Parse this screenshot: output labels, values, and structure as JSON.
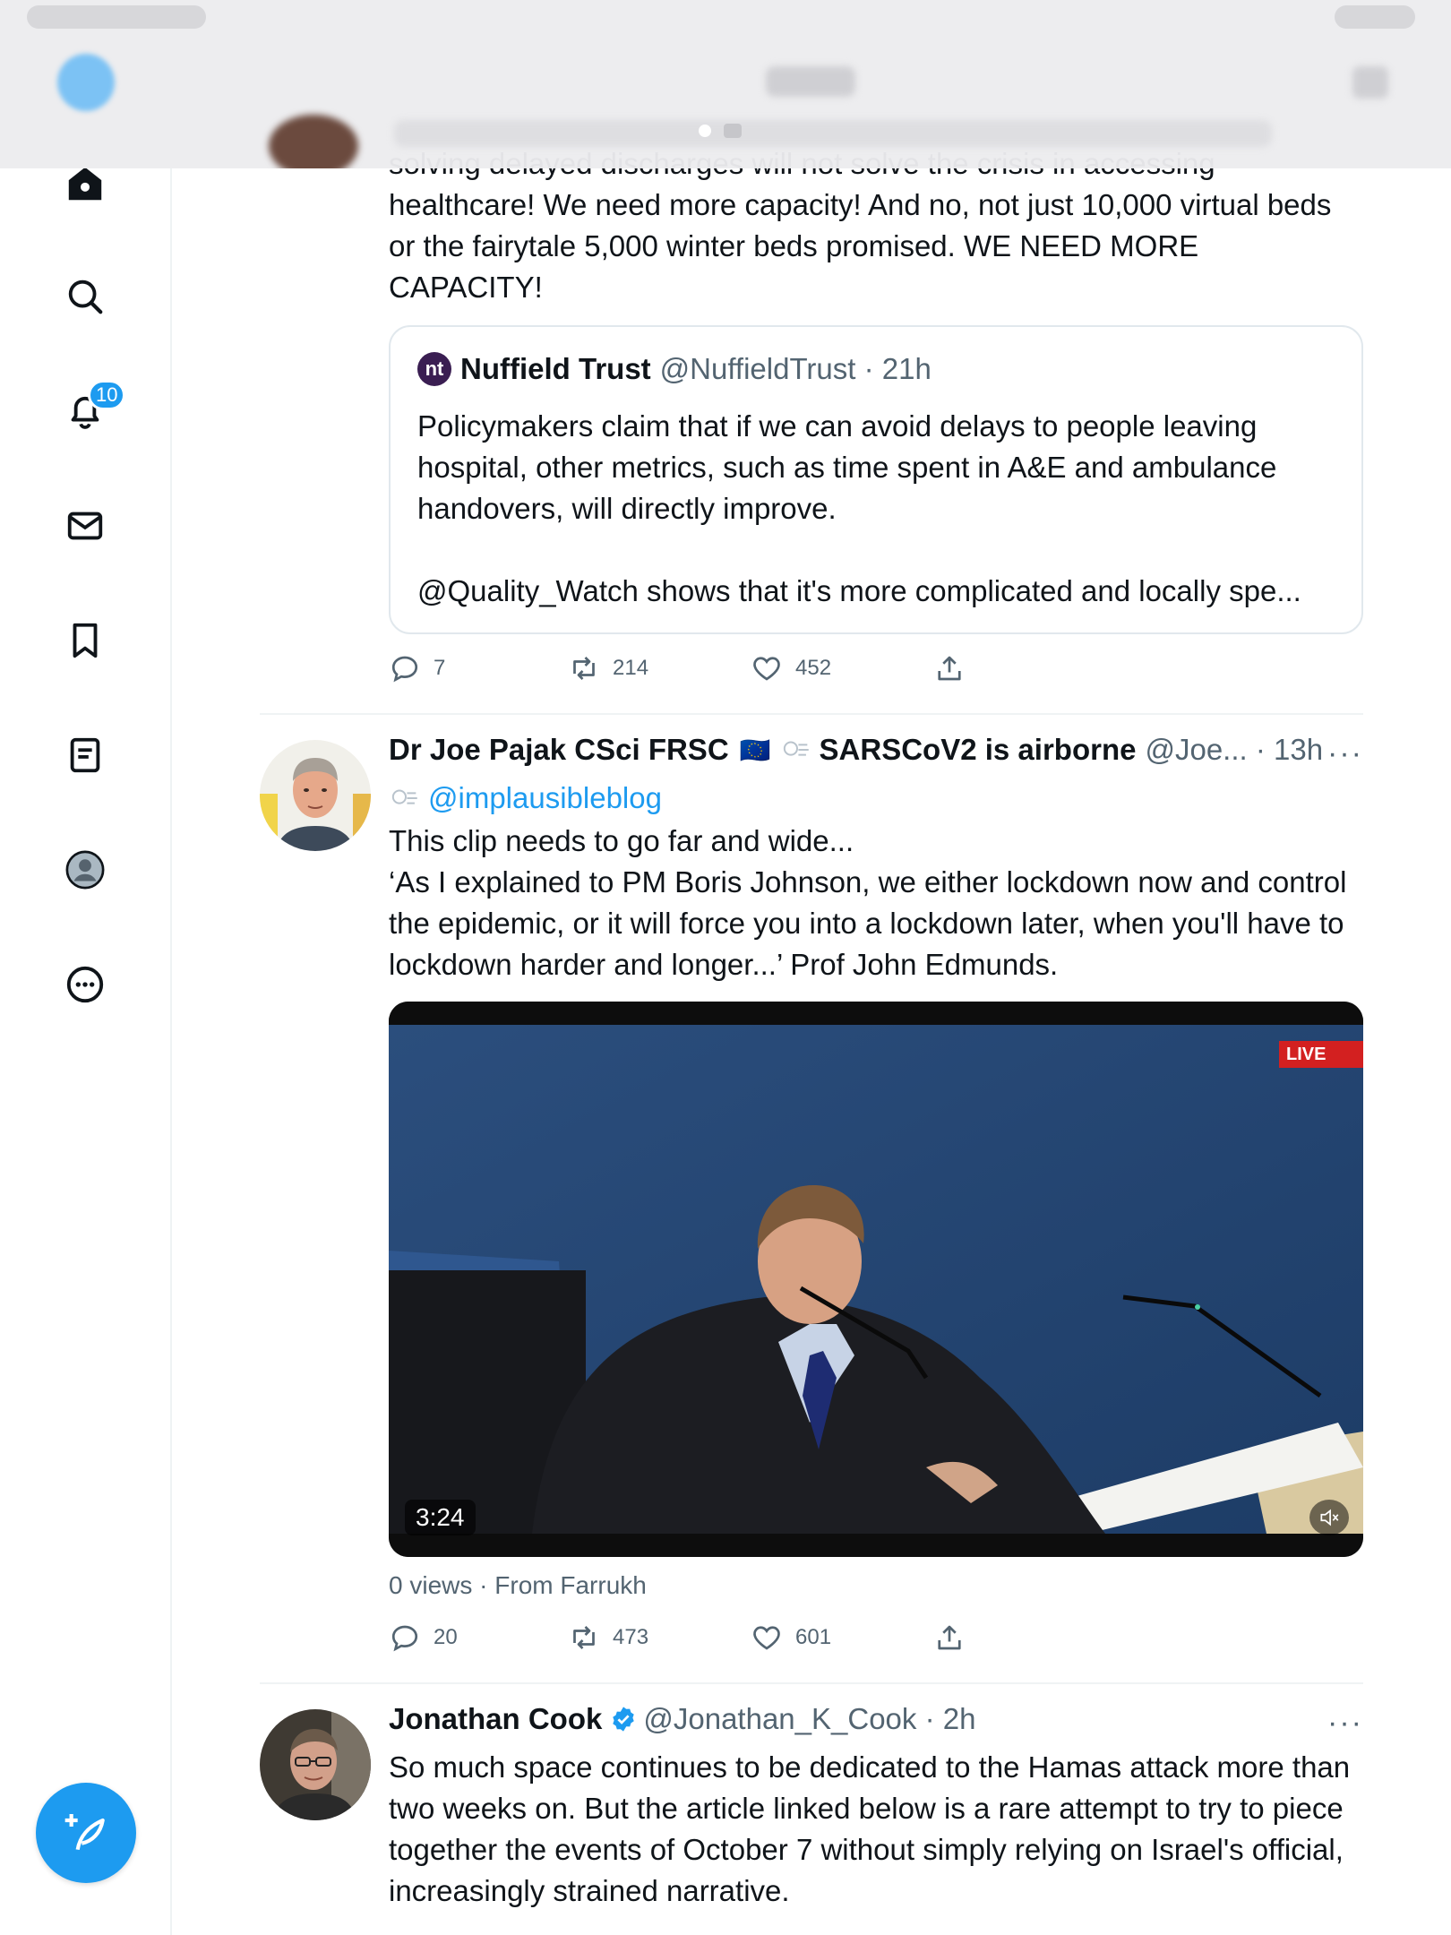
{
  "nav": {
    "notifications_badge": "10"
  },
  "tweet1": {
    "text_partial": "solving delayed discharges will not solve the crisis in accessing",
    "text": "healthcare! We need more capacity! And no, not just 10,000 virtual beds or the fairytale 5,000 winter beds promised. WE NEED MORE CAPACITY!",
    "quote": {
      "logo": "nt",
      "name": "Nuffield Trust",
      "handle": "@NuffieldTrust",
      "time": "21h",
      "body1": "Policymakers claim that if we can avoid delays to people leaving hospital, other metrics, such as time spent in A&E and ambulance handovers, will directly improve.",
      "body2": "@Quality_Watch shows that it's more complicated and locally spe..."
    },
    "actions": {
      "replies": "7",
      "retweets": "214",
      "likes": "452"
    }
  },
  "tweet2": {
    "name": "Dr Joe Pajak CSci FRSC",
    "flag": "🇪🇺",
    "name_suffix": "SARSCoV2 is airborne",
    "handle": "@Joe...",
    "time": "13h",
    "mention": "@implausibleblog",
    "line1": "This clip needs to go far and wide...",
    "line2": "‘As I explained to PM Boris Johnson, we either lockdown now and control the epidemic, or it will force you into a lockdown later, when you'll have to lockdown harder and longer...’ Prof John Edmunds.",
    "video": {
      "duration": "3:24",
      "live_label": "LIVE"
    },
    "views": "0 views",
    "source": "From Farrukh",
    "actions": {
      "replies": "20",
      "retweets": "473",
      "likes": "601"
    }
  },
  "tweet3": {
    "name": "Jonathan Cook",
    "handle": "@Jonathan_K_Cook",
    "time": "2h",
    "text": "So much space continues to be dedicated to the Hamas attack more than two weeks on. But the article linked below is a rare attempt to try to piece together the events of October 7 without simply relying on Israel's official, increasingly strained narrative."
  },
  "colors": {
    "accent": "#1d9bf0",
    "muted": "#536471",
    "text": "#0f1419"
  }
}
